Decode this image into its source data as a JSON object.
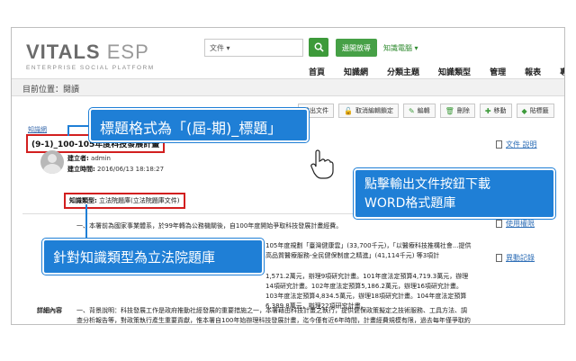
{
  "header": {
    "logo_main": "VITALS",
    "logo_esp": "ESP",
    "logo_sub": "ENTERPRISE SOCIAL PLATFORM",
    "search_select": "文件 ▾",
    "search_icon": "search-icon",
    "pill_1": "邊開放導",
    "user_link": "知識電腦 ▾"
  },
  "nav": {
    "items": [
      "首頁",
      "知識網",
      "分類主題",
      "知識類型",
      "管理",
      "報表",
      "專家"
    ]
  },
  "breadcrumb": "目前位置：閱讀",
  "toolbar": {
    "export_label": "輸出文件",
    "draft_label": "取消編輯鎖定",
    "edit_label": "編輯",
    "delete_label": "刪除",
    "move_label": "移動",
    "tag_label": "貼標籤"
  },
  "record": {
    "category_link": "知識網",
    "title": "(9-1)_100-105年度科技發展計畫",
    "creator_label": "建立者:",
    "creator_value": "admin",
    "created_label": "建立時間:",
    "created_value": "2016/06/13 18:18:27",
    "type_label": "知識類型:",
    "type_value": "立法院題庫(立法院題庫文件)"
  },
  "content": {
    "row1": "一、本署前為國家事業體系，於99年轉為公務機關後，自100年度開始爭取科技發展計畫經費。",
    "row2": "105年度規劃「臺灣健康雲」(33,700千元)，「以醫療科技推構社會...提供高品質醫療服務-全民健保制度之精進」(41,114千元) 等3項計",
    "row3": "1,571.2萬元，辦理9項研究計畫。101年度法定預算4,719.3萬元，辦理14項研究計畫。102年度法定預算5,186.2萬元，辦理16項研究計畫。103年度法定預算4,834.5萬元，辦理18項研究計畫。104年度法定預算6,389.8萬元，辦理22項研究計畫。",
    "detail_label": "詳細內容",
    "row4": "一、背景說明：科技發展工作是政府推動社經發展的重要措施之一，本署藉由科技計畫之執行，提供健保政策擬定之技術服務、工具方法、調查分析報告等，對政策執行產生重要貢獻，惟本署自100年始辦理科技發展計畫，迄今僅有近6年時間，計畫經費規模有限，過去每年僅爭取約5,000萬經費，以每年醫療支出高達5千多億來看，研究經費僅佔約萬之1，比例實在太低，與行政院衛生福利部科技發展計畫經費之1.4%，與國際其他單位相較亦屬偏低。"
  },
  "sidebar": {
    "link1": "文件 說明",
    "link2": "使用權限",
    "link3": "異動記錄"
  },
  "callouts": {
    "c1": "標題格式為「(屆-期)_標題」",
    "c2_line1": "點擊輸出文件按鈕下載",
    "c2_line2": "WORD格式題庫",
    "c3": "針對知識類型為立法院題庫"
  },
  "colors": {
    "accent_green": "#3d9a3a",
    "callout_blue": "#1f7fd6",
    "highlight_red": "#d21f1f"
  }
}
